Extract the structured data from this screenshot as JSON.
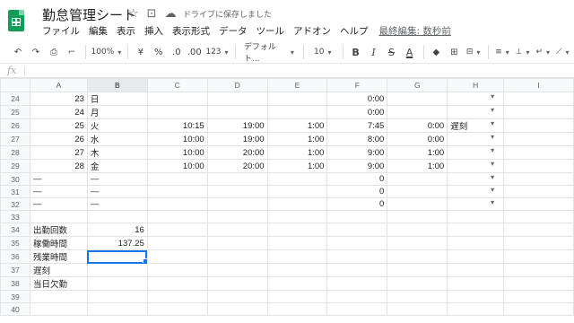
{
  "app": {
    "title": "勤怠管理シート",
    "save_status": "ドライブに保存しました",
    "star_icon": "star-icon",
    "folder_icon": "move-to-folder-icon",
    "cloud_icon": "cloud-saved-icon"
  },
  "menu": {
    "items": [
      "ファイル",
      "編集",
      "表示",
      "挿入",
      "表示形式",
      "データ",
      "ツール",
      "アドオン",
      "ヘルプ"
    ],
    "last_edit": "最終編集: 数秒前"
  },
  "toolbar": {
    "undo": "↶",
    "redo": "↷",
    "print": "⎙",
    "paint_format": "🖌",
    "zoom": "100%",
    "currency": "¥",
    "percent": "%",
    "dec_decrease": ".0",
    "dec_increase": ".00",
    "more_formats": "123",
    "font": "デフォルト...",
    "font_size": "10",
    "bold": "B",
    "italic": "I",
    "strike": "S",
    "text_color": "A",
    "fill": "◆",
    "borders": "⊞",
    "merge": "⊟",
    "halign": "≡",
    "valign": "⊥",
    "wrap": "↵",
    "rotate": "⟋"
  },
  "formula": {
    "fx": "fx",
    "value": ""
  },
  "columns": [
    "A",
    "B",
    "C",
    "D",
    "E",
    "F",
    "G",
    "H",
    "I"
  ],
  "selected_column": "B",
  "rows": [
    {
      "n": "24",
      "a": "23",
      "b": "日",
      "c": "",
      "d": "",
      "e": "",
      "f": "0:00",
      "g": "",
      "h": "",
      "dd": true
    },
    {
      "n": "25",
      "a": "24",
      "b": "月",
      "c": "",
      "d": "",
      "e": "",
      "f": "0:00",
      "g": "",
      "h": "",
      "dd": true
    },
    {
      "n": "26",
      "a": "25",
      "b": "火",
      "c": "10:15",
      "d": "19:00",
      "e": "1:00",
      "f": "7:45",
      "g": "0:00",
      "h": "遅刻",
      "dd": true
    },
    {
      "n": "27",
      "a": "26",
      "b": "水",
      "c": "10:00",
      "d": "19:00",
      "e": "1:00",
      "f": "8:00",
      "g": "0:00",
      "h": "",
      "dd": true
    },
    {
      "n": "28",
      "a": "27",
      "b": "木",
      "c": "10:00",
      "d": "20:00",
      "e": "1:00",
      "f": "9:00",
      "g": "1:00",
      "h": "",
      "dd": true
    },
    {
      "n": "29",
      "a": "28",
      "b": "金",
      "c": "10:00",
      "d": "20:00",
      "e": "1:00",
      "f": "9:00",
      "g": "1:00",
      "h": "",
      "dd": true
    },
    {
      "n": "30",
      "a": "—",
      "b": "—",
      "c": "",
      "d": "",
      "e": "",
      "f": "0",
      "g": "",
      "h": "",
      "dd": true
    },
    {
      "n": "31",
      "a": "—",
      "b": "—",
      "c": "",
      "d": "",
      "e": "",
      "f": "0",
      "g": "",
      "h": "",
      "dd": true
    },
    {
      "n": "32",
      "a": "—",
      "b": "—",
      "c": "",
      "d": "",
      "e": "",
      "f": "0",
      "g": "",
      "h": "",
      "dd": true
    },
    {
      "n": "33",
      "a": "",
      "b": "",
      "c": "",
      "d": "",
      "e": "",
      "f": "",
      "g": "",
      "h": "",
      "dd": false
    },
    {
      "n": "34",
      "a": "出勤回数",
      "b": "16",
      "c": "",
      "d": "",
      "e": "",
      "f": "",
      "g": "",
      "h": "",
      "dd": false
    },
    {
      "n": "35",
      "a": "稼働時間",
      "b": "137.25",
      "c": "",
      "d": "",
      "e": "",
      "f": "",
      "g": "",
      "h": "",
      "dd": false
    },
    {
      "n": "36",
      "a": "残業時間",
      "b": "",
      "c": "",
      "d": "",
      "e": "",
      "f": "",
      "g": "",
      "h": "",
      "dd": false,
      "selected": true
    },
    {
      "n": "37",
      "a": "遅刻",
      "b": "",
      "c": "",
      "d": "",
      "e": "",
      "f": "",
      "g": "",
      "h": "",
      "dd": false
    },
    {
      "n": "38",
      "a": "当日欠勤",
      "b": "",
      "c": "",
      "d": "",
      "e": "",
      "f": "",
      "g": "",
      "h": "",
      "dd": false
    },
    {
      "n": "39",
      "a": "",
      "b": "",
      "c": "",
      "d": "",
      "e": "",
      "f": "",
      "g": "",
      "h": "",
      "dd": false
    },
    {
      "n": "40",
      "a": "",
      "b": "",
      "c": "",
      "d": "",
      "e": "",
      "f": "",
      "g": "",
      "h": "",
      "dd": false
    }
  ],
  "colors": {
    "brand": "#0f9d58",
    "selection": "#1a73e8"
  }
}
